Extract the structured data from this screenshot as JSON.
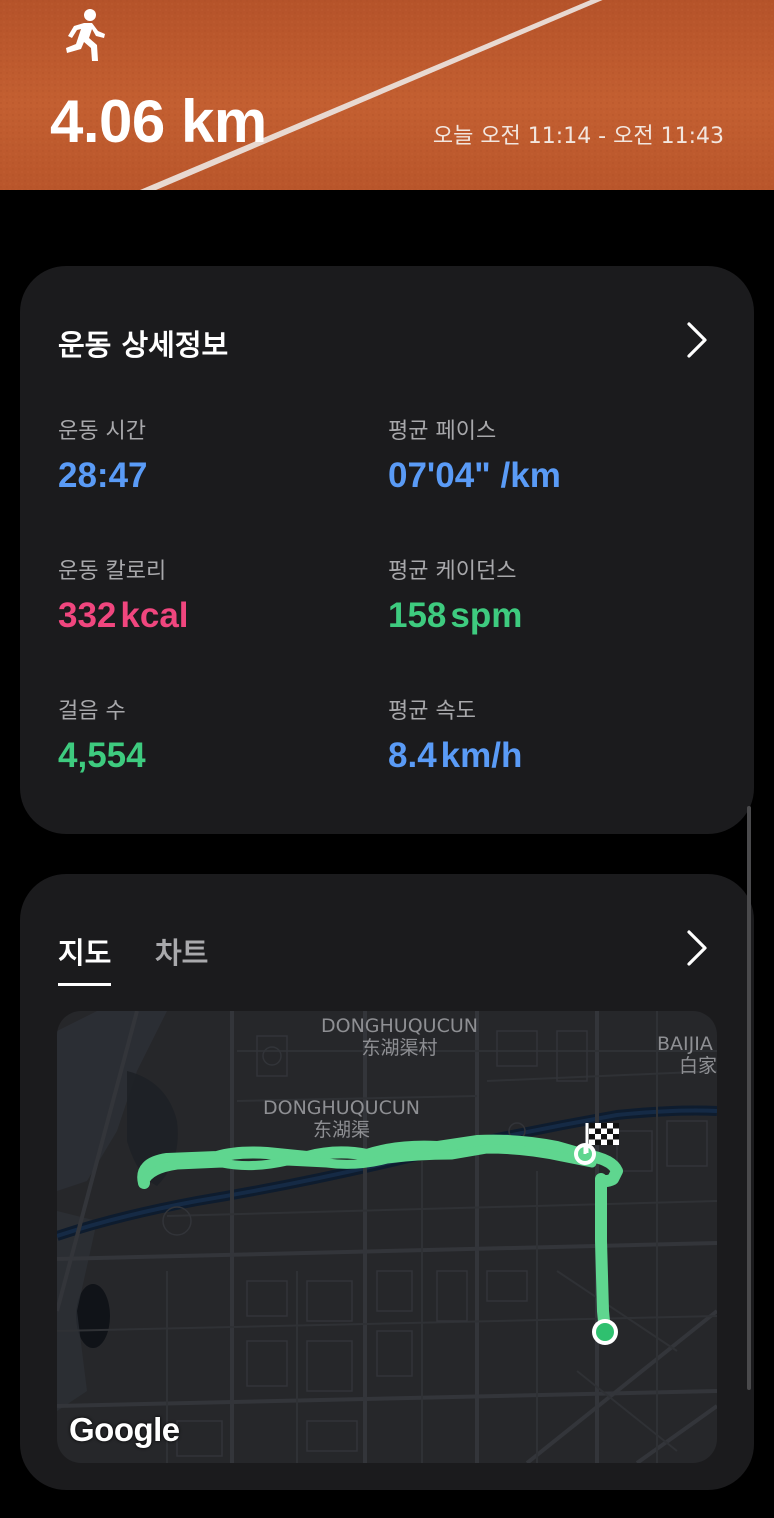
{
  "header": {
    "activity_icon": "running-person-icon",
    "distance": "4.06 km",
    "time_range": "오늘 오전 11:14 - 오전 11:43"
  },
  "details": {
    "title": "운동 상세정보",
    "stats": [
      {
        "label": "운동 시간",
        "value": "28:47",
        "unit": "",
        "color": "#5a9bf6"
      },
      {
        "label": "평균 페이스",
        "value": "07'04\" /km",
        "unit": "",
        "color": "#5a9bf6"
      },
      {
        "label": "운동 칼로리",
        "value": "332",
        "unit": "kcal",
        "color": "#f0467e"
      },
      {
        "label": "평균 케이던스",
        "value": "158",
        "unit": "spm",
        "color": "#3ecb7f"
      },
      {
        "label": "걸음 수",
        "value": "4,554",
        "unit": "",
        "color": "#3ecb7f"
      },
      {
        "label": "평균 속도",
        "value": "8.4",
        "unit": "km/h",
        "color": "#5a9bf6"
      }
    ]
  },
  "map_card": {
    "tabs": [
      "지도",
      "차트"
    ],
    "active_tab": "지도",
    "labels": {
      "donghuqucun_top_en": "DONGHUQUCUN",
      "donghuqucun_top_zh": "东湖渠村",
      "donghuqucun_mid_en": "DONGHUQUCUN",
      "donghuqucun_mid_zh": "东湖渠",
      "baijia_en": "BAIJIA",
      "baijia_zh": "白家"
    },
    "logo": "Google",
    "route_color": "#5fd68f"
  }
}
